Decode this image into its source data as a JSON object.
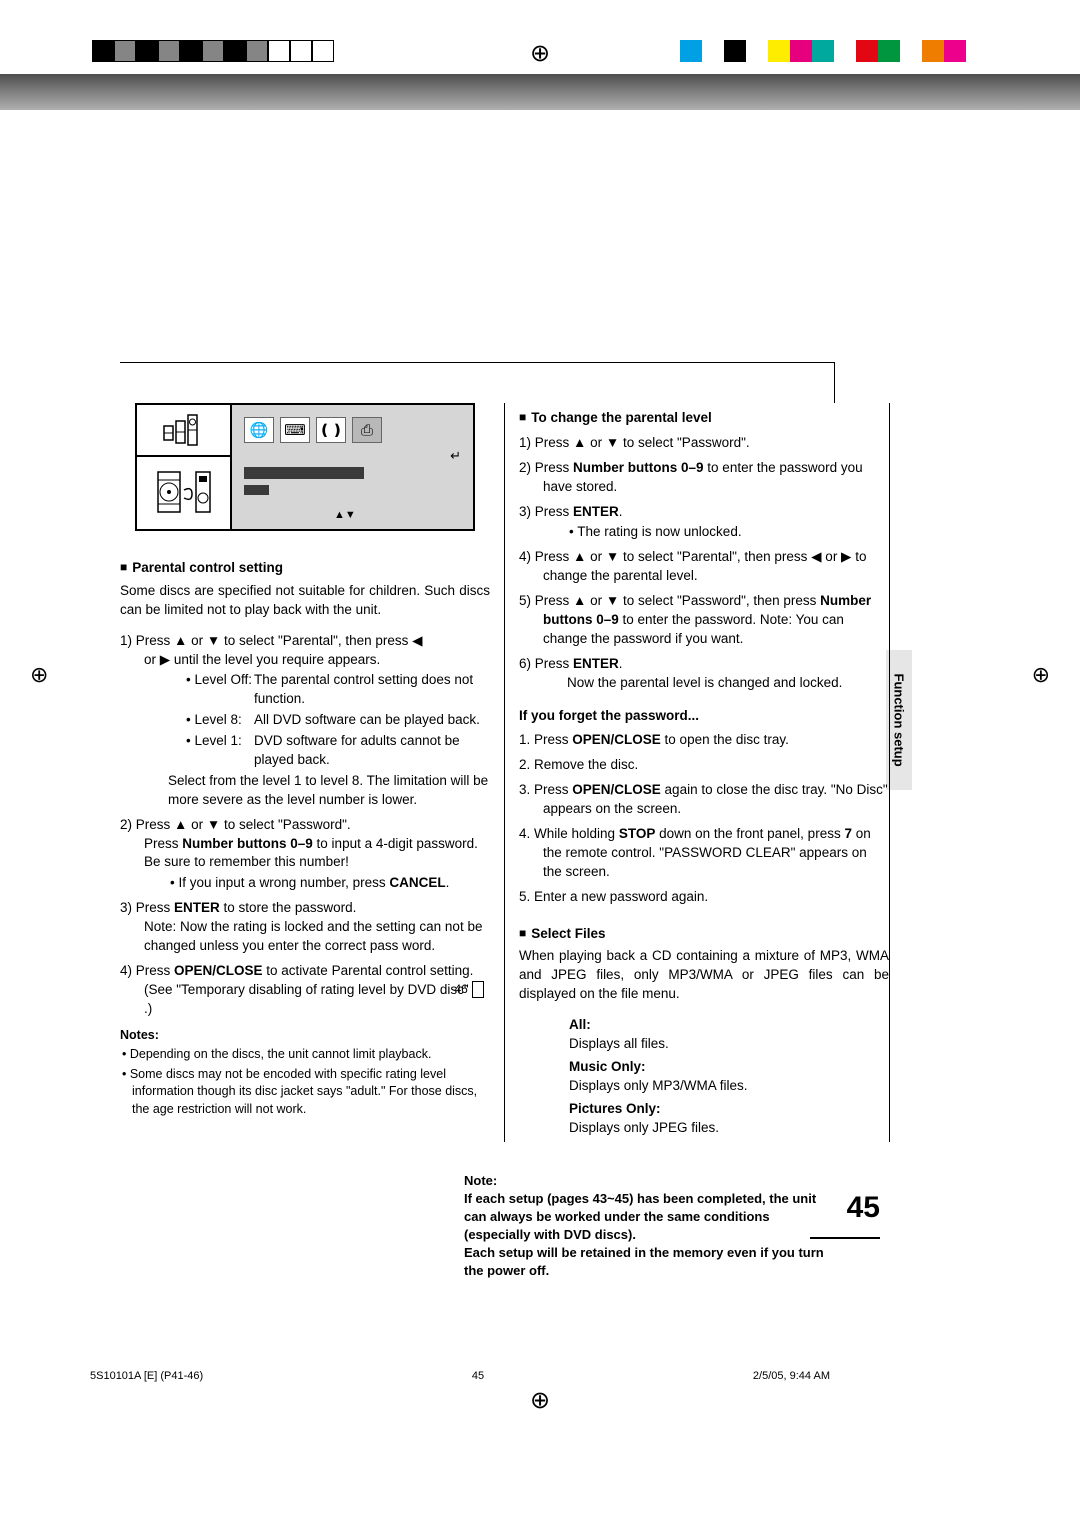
{
  "printmarks": {
    "topReg": "⊕",
    "bottomReg": "⊕",
    "colorbar": [
      "#00a1e4",
      "#ffffff",
      "#000000",
      "#ffffff",
      "#ffed00",
      "#e6007e",
      "#00a99d",
      "#ffffff",
      "#e30613",
      "#009640",
      "#ffffff",
      "#ef7d00",
      "#ec008c",
      "#ffffff"
    ]
  },
  "sideTab": "Function setup",
  "osd": {
    "globeIcon": "🌐",
    "tvIcon": "⌨",
    "audioIcon": "❪❫",
    "lockIcon": "⎙",
    "returnArrow": "↵",
    "updown": "▲▼"
  },
  "left": {
    "h1": "Parental control setting",
    "intro": "Some discs are specified not suitable for children. Such discs can be limited not to play back with the unit.",
    "step1a": "1)  Press ▲ or ▼ to select \"Parental\", then press ◀",
    "step1b": "or ▶ until the level you require appears.",
    "lvlOff_l": "• Level Off:",
    "lvlOff_t": "The parental control setting does not function.",
    "lvl8_l": "• Level 8:",
    "lvl8_t": "All DVD software can be played back.",
    "lvl1_l": "• Level 1:",
    "lvl1_t": "DVD software for adults cannot be played back.",
    "step1c": "Select from the level 1 to level 8. The limitation will be more severe as the level number is lower.",
    "step2a": "2)  Press ▲ or ▼ to select \"Password\".",
    "step2b_1": "Press ",
    "step2b_b1": "Number buttons 0–9",
    "step2b_2": " to input a 4-digit password. Be sure to remember this number!",
    "step2c_1": "• If you input a wrong number, press ",
    "step2c_b": "CANCEL",
    "step2c_2": ".",
    "step3a_1": "3)  Press ",
    "step3a_b": "ENTER",
    "step3a_2": " to store the password.",
    "step3b": "Note: Now the rating is locked and the setting can not be changed unless you enter the correct pass word.",
    "step4a_1": "4)  Press ",
    "step4a_b": "OPEN/CLOSE",
    "step4a_2": " to activate Parental control setting. (See \"Temporary disabling of rating level by DVD disc\" ",
    "step4a_page": "46",
    "step4a_3": ".)",
    "notesHead": "Notes:",
    "note1": "• Depending on the discs, the unit cannot limit playback.",
    "note2": "• Some discs may not be encoded with specific rating level information though its disc jacket says \"adult.\" For those discs, the age restriction will not work."
  },
  "right": {
    "h1": "To change the parental level",
    "s1": "1)  Press ▲ or ▼ to select \"Password\".",
    "s2_1": "2)  Press ",
    "s2_b": "Number buttons 0–9",
    "s2_2": " to enter the password you have stored.",
    "s3_1": "3)  Press ",
    "s3_b": "ENTER",
    "s3_2": ".",
    "s3_sub": "• The rating is now unlocked.",
    "s4": "4)  Press ▲ or ▼ to select \"Parental\", then press ◀ or ▶ to change the parental level.",
    "s5_1": "5)  Press ▲ or ▼ to select \"Password\", then press ",
    "s5_b": "Number buttons 0–9",
    "s5_2": " to enter the password. Note: You can change the password if you want.",
    "s6_1": "6)  Press ",
    "s6_b": "ENTER",
    "s6_2": ".",
    "s6_sub": "Now the parental level is changed and locked.",
    "forgotHead": "If you forget the password...",
    "f1_1": "1.  Press ",
    "f1_b": "OPEN/CLOSE",
    "f1_2": " to open the disc tray.",
    "f2": "2.  Remove the disc.",
    "f3_1": "3.  Press ",
    "f3_b": "OPEN/CLOSE",
    "f3_2": " again to close the disc tray. \"No Disc\" appears on the screen.",
    "f4_1": "4.  While holding ",
    "f4_b1": "STOP",
    "f4_2": " down on the front panel, press ",
    "f4_b2": "7",
    "f4_3": " on the remote control. \"PASSWORD CLEAR\" appears on the screen.",
    "f5": "5.  Enter a new password again.",
    "selHead": "Select Files",
    "selIntro": "When playing back a CD containing a mixture of MP3, WMA and JPEG files, only MP3/WMA or JPEG files can be displayed on the file menu.",
    "all_l": "All:",
    "all_t": "Displays all files.",
    "mus_l": "Music Only:",
    "mus_t": "Displays only MP3/WMA files.",
    "pic_l": "Pictures Only:",
    "pic_t": "Displays only JPEG files."
  },
  "bottomNote": {
    "l1": "Note:",
    "l2": "If each setup (pages 43~45) has been completed, the unit can always be worked under the same conditions (especially with DVD discs).",
    "l3": "Each setup will be retained in the memory even if you turn the power off."
  },
  "pageNumber": "45",
  "footer": {
    "left": "5S10101A [E] (P41-46)",
    "center": "45",
    "right": "2/5/05, 9:44 AM"
  }
}
